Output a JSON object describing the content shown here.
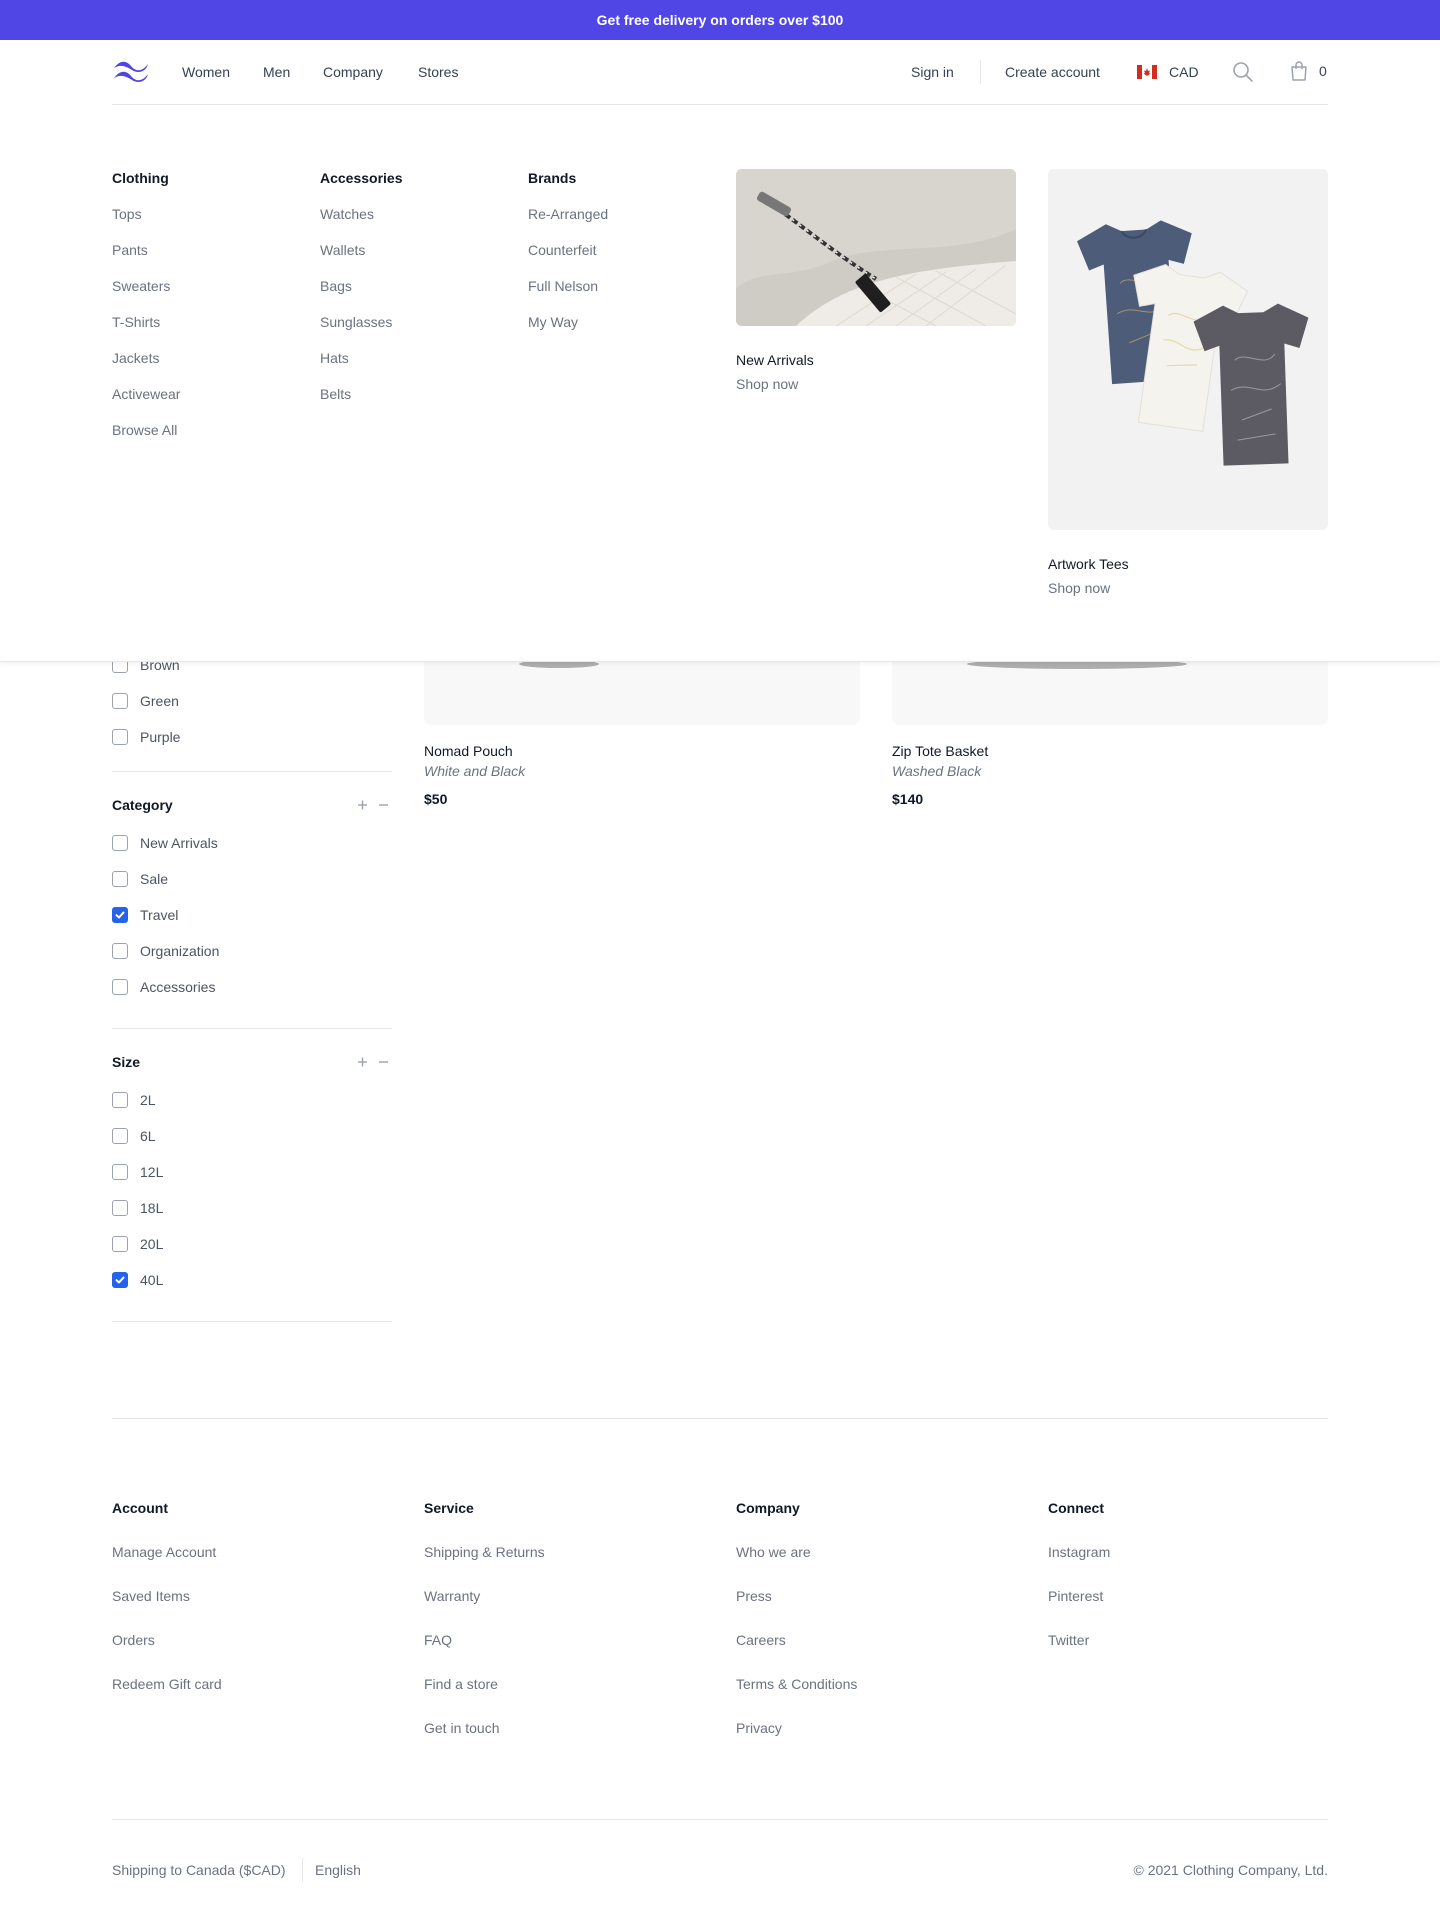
{
  "banner": {
    "text": "Get free delivery on orders over $100"
  },
  "header": {
    "logo": "wave-logo",
    "nav": [
      "Women",
      "Men",
      "Company",
      "Stores"
    ],
    "sign_in": "Sign in",
    "create_account": "Create account",
    "currency": "CAD",
    "cart_count": "0"
  },
  "mega_menu": {
    "columns": [
      {
        "title": "Clothing",
        "items": [
          "Tops",
          "Pants",
          "Sweaters",
          "T-Shirts",
          "Jackets",
          "Activewear",
          "Browse All"
        ]
      },
      {
        "title": "Accessories",
        "items": [
          "Watches",
          "Wallets",
          "Bags",
          "Sunglasses",
          "Hats",
          "Belts"
        ]
      },
      {
        "title": "Brands",
        "items": [
          "Re-Arranged",
          "Counterfeit",
          "Full Nelson",
          "My Way"
        ]
      }
    ],
    "featured": [
      {
        "title": "New Arrivals",
        "cta": "Shop now"
      },
      {
        "title": "Artwork Tees",
        "cta": "Shop now"
      }
    ]
  },
  "filters": {
    "color_items": [
      {
        "label": "Brown",
        "checked": false
      },
      {
        "label": "Green",
        "checked": false
      },
      {
        "label": "Purple",
        "checked": false
      }
    ],
    "category": {
      "title": "Category",
      "items": [
        {
          "label": "New Arrivals",
          "checked": false
        },
        {
          "label": "Sale",
          "checked": false
        },
        {
          "label": "Travel",
          "checked": true
        },
        {
          "label": "Organization",
          "checked": false
        },
        {
          "label": "Accessories",
          "checked": false
        }
      ]
    },
    "size": {
      "title": "Size",
      "items": [
        {
          "label": "2L",
          "checked": false
        },
        {
          "label": "6L",
          "checked": false
        },
        {
          "label": "12L",
          "checked": false
        },
        {
          "label": "18L",
          "checked": false
        },
        {
          "label": "20L",
          "checked": false
        },
        {
          "label": "40L",
          "checked": true
        }
      ]
    }
  },
  "products": [
    {
      "name": "Nomad Pouch",
      "variant": "White and Black",
      "price": "$50"
    },
    {
      "name": "Zip Tote Basket",
      "variant": "Washed Black",
      "price": "$140"
    }
  ],
  "footer": {
    "columns": [
      {
        "title": "Account",
        "items": [
          "Manage Account",
          "Saved Items",
          "Orders",
          "Redeem Gift card"
        ]
      },
      {
        "title": "Service",
        "items": [
          "Shipping & Returns",
          "Warranty",
          "FAQ",
          "Find a store",
          "Get in touch"
        ]
      },
      {
        "title": "Company",
        "items": [
          "Who we are",
          "Press",
          "Careers",
          "Terms & Conditions",
          "Privacy"
        ]
      },
      {
        "title": "Connect",
        "items": [
          "Instagram",
          "Pinterest",
          "Twitter"
        ]
      }
    ],
    "shipping": "Shipping to Canada ($CAD)",
    "language": "English",
    "copyright": "© 2021 Clothing Company, Ltd."
  },
  "colors": {
    "brand": "#4f46e5",
    "checkbox_checked": "#2563eb"
  }
}
